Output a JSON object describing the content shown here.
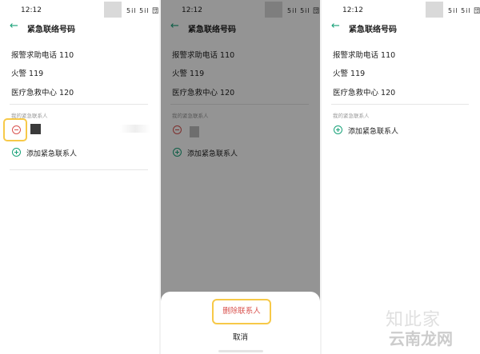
{
  "status": {
    "time": "12:12",
    "signal": "5il 5il 団"
  },
  "header": {
    "back_icon": "←",
    "title": "紧急联络号码"
  },
  "emergency_numbers": [
    "报警求助电话 110",
    "火警 119",
    "医疗急救中心 120"
  ],
  "section_label": "我的紧急联系人",
  "add_contact_label": "添加紧急联系人",
  "sheet": {
    "delete_label": "删除联系人",
    "cancel_label": "取消"
  },
  "watermark": {
    "line1": "知此家",
    "line2": "云南龙网"
  },
  "colors": {
    "accent": "#1aa37a",
    "danger": "#d9534f",
    "highlight": "#f7c948"
  }
}
